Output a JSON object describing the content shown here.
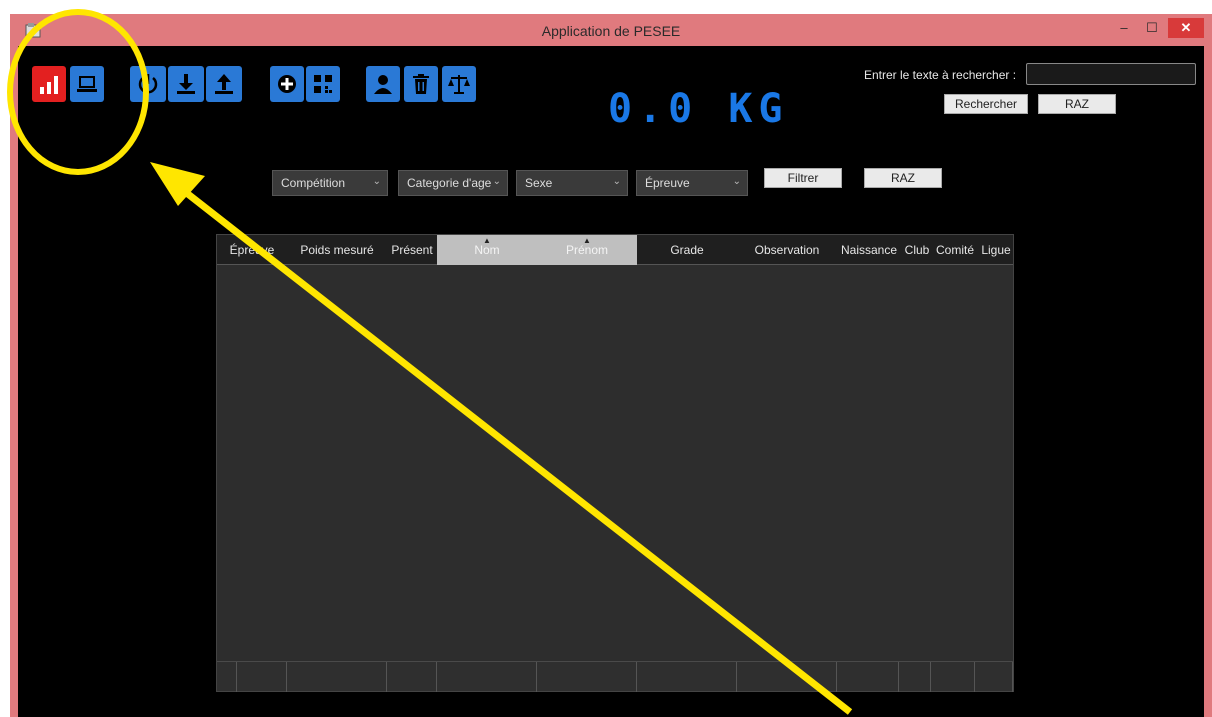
{
  "window": {
    "title": "Application de PESEE",
    "minimize": "–",
    "maximize": "☐",
    "close": "✕"
  },
  "toolbar": {
    "icons": [
      "stats-icon",
      "laptop-icon",
      "power-icon",
      "download-icon",
      "upload-icon",
      "add-icon",
      "qrcode-icon",
      "user-icon",
      "trash-icon",
      "scale-icon"
    ]
  },
  "weight_display": "0.0 KG",
  "search": {
    "label": "Entrer le texte à rechercher :",
    "value": "",
    "search_button": "Rechercher",
    "reset_button": "RAZ"
  },
  "filters": {
    "competition": "Compétition",
    "age_category": "Categorie d'age",
    "sex": "Sexe",
    "event": "Épreuve",
    "filter_button": "Filtrer",
    "reset_button": "RAZ"
  },
  "table": {
    "columns": [
      "Épreuve",
      "Poids mesuré",
      "Présent",
      "Nom",
      "Prénom",
      "Grade",
      "Observation",
      "Naissance",
      "Club",
      "Comité",
      "Ligue"
    ],
    "sorted_columns": [
      "Nom",
      "Prénom"
    ],
    "rows": []
  },
  "colors": {
    "frame": "#e07a7e",
    "accent": "#2a79d6",
    "highlight": "#e32020",
    "annotation": "#ffe600"
  }
}
